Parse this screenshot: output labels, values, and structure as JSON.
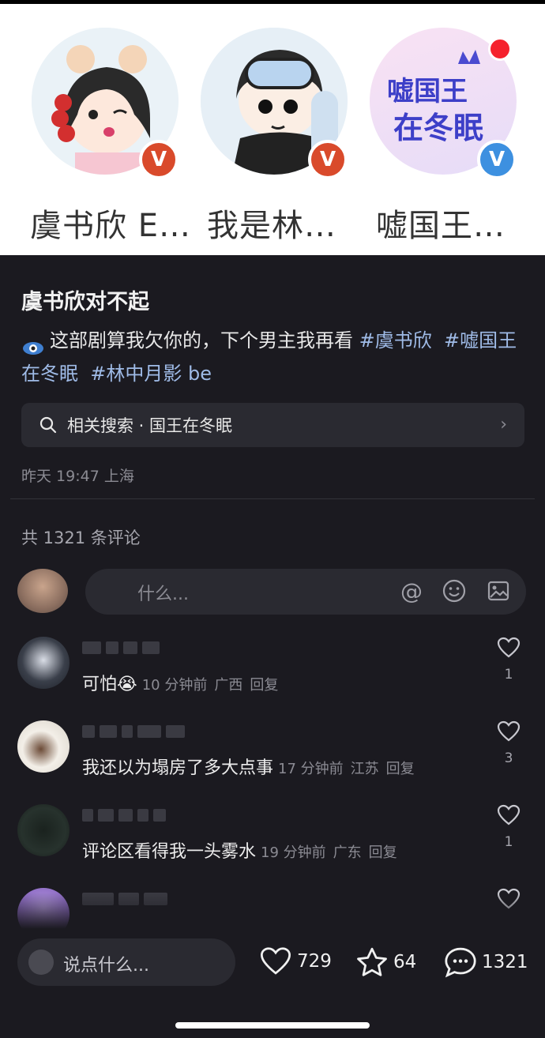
{
  "creators": [
    {
      "name": "虞书欣 E…",
      "badge": "V",
      "badge_color": "#d94a2b"
    },
    {
      "name": "我是林…",
      "badge": "V",
      "badge_color": "#d94a2b"
    },
    {
      "name": "嘘国王…",
      "badge": "V",
      "badge_color": "#3d90e0",
      "avatar_text": "嘘国王\n在冬眠"
    }
  ],
  "post": {
    "title": "虞书欣对不起",
    "body_text": "这部剧算我欠你的，下个男主我再看",
    "tags": [
      "#虞书欣",
      "#嘘国王在冬眠",
      "#林中月影 be"
    ],
    "related_search": "相关搜索 · 国王在冬眠",
    "time_location": "昨天 19:47 上海"
  },
  "comments_header": {
    "count_text": "共 1321 条评论",
    "input_placeholder": "什么..."
  },
  "comments": [
    {
      "text": "可怕😭",
      "time": "10 分钟前",
      "location": "广西",
      "reply": "回复",
      "likes": "1",
      "avatar_color": "#3a3f4a"
    },
    {
      "text": "我还以为塌房了多大点事",
      "time": "17 分钟前",
      "location": "江苏",
      "reply": "回复",
      "likes": "3",
      "avatar_color": "#d8d2c8"
    },
    {
      "text": "评论区看得我一头雾水",
      "time": "19 分钟前",
      "location": "广东",
      "reply": "回复",
      "likes": "1",
      "avatar_color": "#27322d"
    },
    {
      "text": "",
      "time": "",
      "location": "",
      "reply": "",
      "likes": "",
      "avatar_color": "#8d6bc4"
    }
  ],
  "bottom_bar": {
    "placeholder": "说点什么...",
    "likes": "729",
    "favorites": "64",
    "comments": "1321"
  },
  "colors": {
    "background": "#1b1a20",
    "surface": "#2a2a31",
    "tag": "#9fbbe7",
    "notification_dot": "#f5222d"
  }
}
